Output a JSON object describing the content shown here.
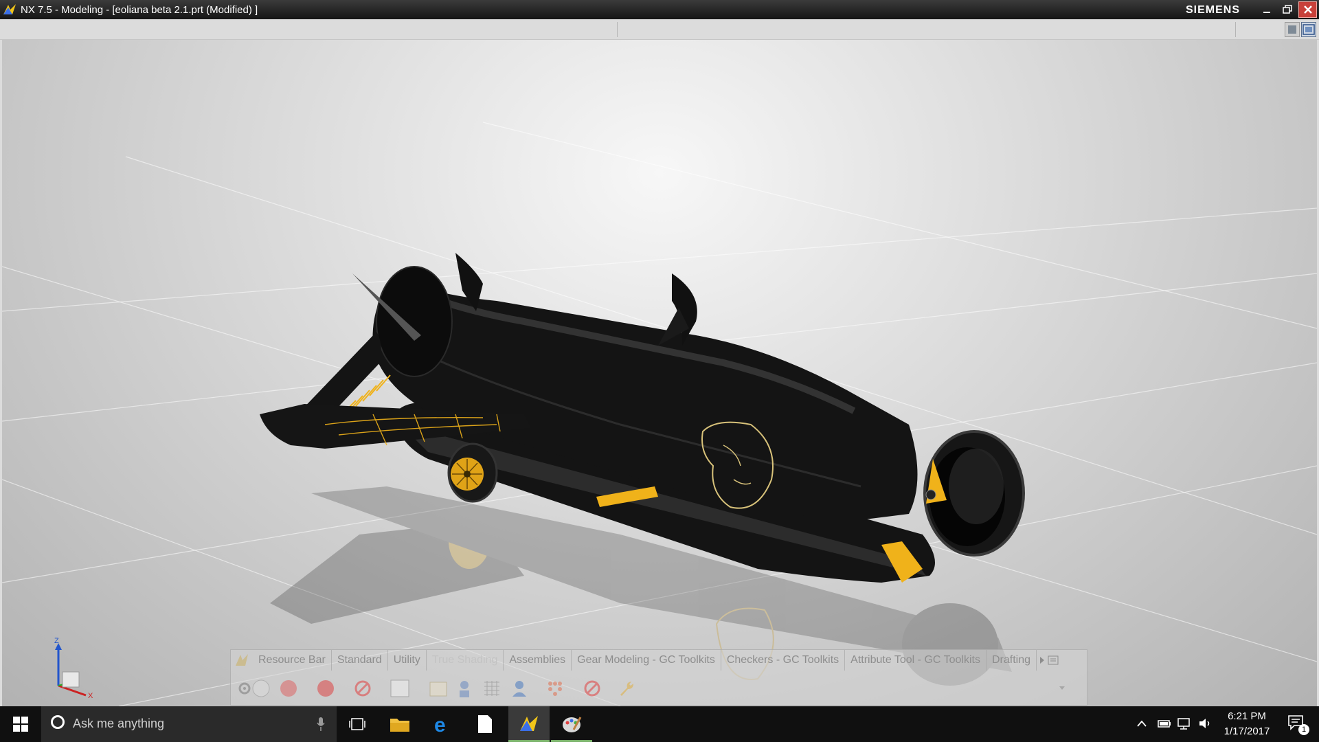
{
  "window": {
    "title": "NX 7.5 - Modeling - [eoliana beta 2.1.prt (Modified) ]",
    "brand": "SIEMENS",
    "minimize_icon": "minimize-icon",
    "restore_icon": "restore-icon",
    "close_icon": "close-icon"
  },
  "viewport": {
    "model": "eoliana-aircraft-render",
    "triad": {
      "z": "Z",
      "x": "X"
    }
  },
  "toolbar": {
    "tabs": [
      {
        "label": "Resource Bar"
      },
      {
        "label": "Standard"
      },
      {
        "label": "Utility"
      },
      {
        "label": "True Shading"
      },
      {
        "label": "Assemblies"
      },
      {
        "label": "Gear Modeling - GC Toolkits"
      },
      {
        "label": "Checkers - GC Toolkits"
      },
      {
        "label": "Attribute Tool - GC Toolkits"
      },
      {
        "label": "Drafting"
      }
    ],
    "tools": [
      "sphere-material-icon",
      "red-sphere-icon",
      "dark-sphere-icon",
      "no-symbol-icon",
      "panel-icon",
      "scene-icon",
      "person-icon",
      "grid-icon",
      "user-icon",
      "dots-icon",
      "no-symbol-icon",
      "wrench-icon"
    ]
  },
  "taskbar": {
    "search_placeholder": "Ask me anything",
    "time": "6:21 PM",
    "date": "1/17/2017",
    "notification_count": "1"
  },
  "colors": {
    "accent": "#f0b21a",
    "body": "#111111",
    "close": "#c8413a"
  }
}
